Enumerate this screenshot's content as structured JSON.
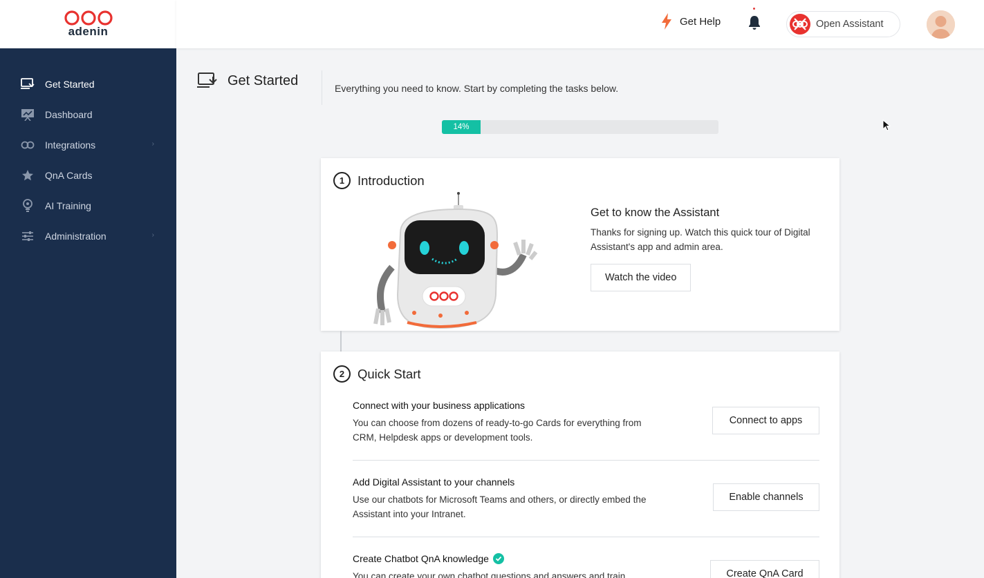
{
  "brand": {
    "logo_text": "adenin",
    "accent": "#e8322f",
    "sidebar_bg": "#1a2e4c",
    "teal": "#14c0a4"
  },
  "header": {
    "help_label": "Get Help",
    "assistant_label": "Open Assistant"
  },
  "sidebar": {
    "items": [
      {
        "label": "Get Started",
        "icon": "monitor-icon"
      },
      {
        "label": "Dashboard",
        "icon": "chart-board-icon"
      },
      {
        "label": "Integrations",
        "icon": "infinity-icon"
      },
      {
        "label": "QnA Cards",
        "icon": "star-icon"
      },
      {
        "label": "AI Training",
        "icon": "lightbulb-icon"
      },
      {
        "label": "Administration",
        "icon": "sliders-icon"
      }
    ]
  },
  "page": {
    "title": "Get Started",
    "subtitle": "Everything you need to know. Start by completing the tasks below.",
    "progress_label": "14%",
    "progress_value": 0.14
  },
  "intro": {
    "step": "1",
    "title": "Introduction",
    "heading": "Get to know the Assistant",
    "body": "Thanks for signing up. Watch this quick tour of Digital Assistant's app and admin area.",
    "button": "Watch the video"
  },
  "quick": {
    "step": "2",
    "title": "Quick Start",
    "tasks": [
      {
        "title": "Connect with your business applications",
        "body": "You can choose from dozens of ready-to-go Cards for everything from CRM, Helpdesk apps or development tools.",
        "button": "Connect to apps"
      },
      {
        "title": "Add Digital Assistant to your channels",
        "body": "Use our chatbots for Microsoft Teams and others, or directly embed the Assistant into your Intranet.",
        "button": "Enable channels"
      },
      {
        "title": "Create Chatbot QnA knowledge",
        "body": "You can create your own chatbot questions and answers and train",
        "button": "Create QnA Card"
      }
    ]
  }
}
